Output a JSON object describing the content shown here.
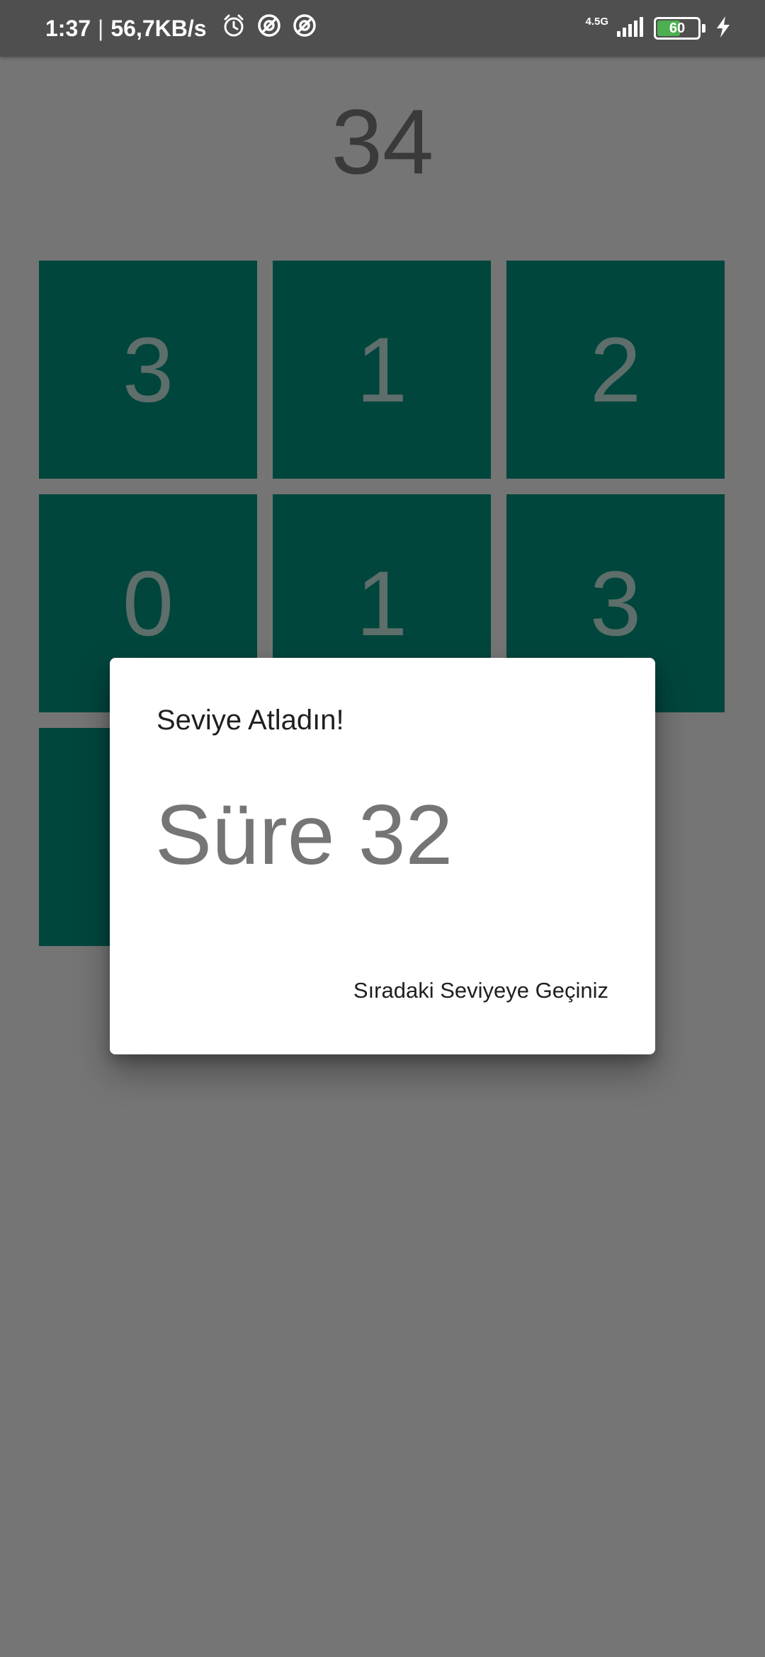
{
  "status_bar": {
    "time": "1:37",
    "separator": "|",
    "speed": "56,7KB/s",
    "left_icons": [
      "alarm-icon",
      "sync-icon",
      "sync-icon"
    ],
    "network_type": "4.5G",
    "battery_level": "60",
    "battery_fraction": 0.6,
    "charging_icon": "bolt-icon"
  },
  "game": {
    "score": "34",
    "tiles": [
      "3",
      "1",
      "2",
      "0",
      "1",
      "3",
      "",
      "",
      ""
    ],
    "tile_color": "#00463d",
    "background_color": "#757575"
  },
  "dialog": {
    "title": "Seviye Atladın!",
    "time_label": "Süre 32",
    "action_label": "Sıradaki Seviyeye Geçiniz"
  }
}
